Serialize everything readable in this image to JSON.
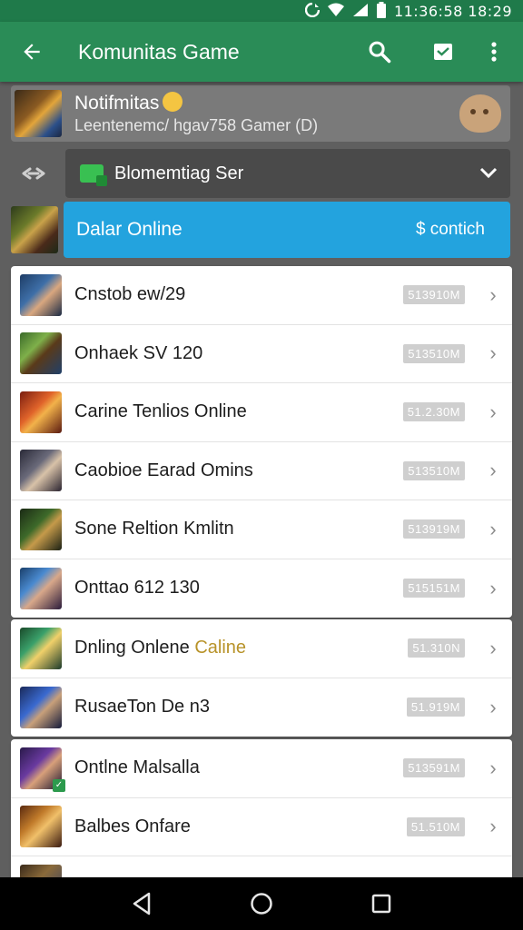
{
  "status_bar": {
    "time_text": "11:36:58 18:29",
    "icons": [
      "data-sync-icon",
      "wifi-icon",
      "signal-icon",
      "battery-icon"
    ]
  },
  "app_bar": {
    "title": "Komunitas Game",
    "back_icon": "arrow-left-icon",
    "actions": [
      "search-icon",
      "inbox-icon",
      "more-vert-icon"
    ]
  },
  "notification": {
    "title": "Notifmitas",
    "subtitle": "Leentenemc/ hgav758 Gamer (D)",
    "avatar_icon": "chat-bubble-icon"
  },
  "server_select": {
    "link_icon": "link-icon",
    "label": "Blomemtiag Ser",
    "chevron": "chevron-down-icon"
  },
  "banner": {
    "label": "Dalar Online",
    "action": "$ contich"
  },
  "list_group_1": [
    {
      "name": "Cnstob ew/29",
      "badge": "513910M"
    },
    {
      "name": "Onhaek SV 120",
      "badge": "513510M"
    },
    {
      "name": "Carine Tenlios Online",
      "badge": "51.2.30M"
    },
    {
      "name": "Caobioe Earad Omins",
      "badge": "513510M"
    },
    {
      "name": "Sone Reltion Kmlitn",
      "badge": "513919M"
    },
    {
      "name": "Onttao 612 130",
      "badge": "515151M"
    }
  ],
  "list_group_2": [
    {
      "name": "Dnling Onlene",
      "name_highlight": "Caline",
      "badge": "51.310N"
    },
    {
      "name": "RusaeTon De n3",
      "badge": "51.919M"
    }
  ],
  "list_group_3": [
    {
      "name": "Ontlne Malsalla",
      "badge": "513591M"
    },
    {
      "name": "Balbes Onfare",
      "badge": "51.510M"
    },
    {
      "name": "",
      "badge": ""
    }
  ],
  "nav_bar": [
    "back-triangle-icon",
    "home-circle-icon",
    "recents-square-icon"
  ],
  "colors": {
    "status_bar": "#1f7a4a",
    "app_bar": "#2a8c57",
    "banner": "#23a3de",
    "highlight_text": "#b8932a"
  }
}
